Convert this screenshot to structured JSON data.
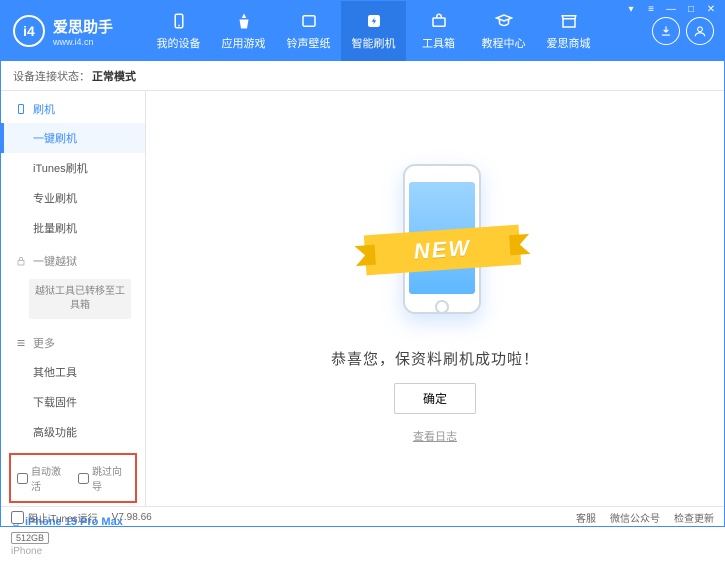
{
  "app": {
    "title": "爱思助手",
    "url": "www.i4.cn"
  },
  "nav": [
    {
      "label": "我的设备"
    },
    {
      "label": "应用游戏"
    },
    {
      "label": "铃声壁纸"
    },
    {
      "label": "智能刷机"
    },
    {
      "label": "工具箱"
    },
    {
      "label": "教程中心"
    },
    {
      "label": "爱思商城"
    }
  ],
  "status": {
    "label": "设备连接状态：",
    "value": "正常模式"
  },
  "sidebar": {
    "flash_group": "刷机",
    "flash_items": [
      "一键刷机",
      "iTunes刷机",
      "专业刷机",
      "批量刷机"
    ],
    "jailbreak_group": "一键越狱",
    "jailbreak_note": "越狱工具已转移至工具箱",
    "more_group": "更多",
    "more_items": [
      "其他工具",
      "下载固件",
      "高级功能"
    ],
    "chk_auto": "自动激活",
    "chk_skip": "跳过向导"
  },
  "device": {
    "name": "iPhone 15 Pro Max",
    "storage": "512GB",
    "type": "iPhone"
  },
  "main": {
    "ribbon": "NEW",
    "message": "恭喜您，保资料刷机成功啦！",
    "ok": "确定",
    "log": "查看日志"
  },
  "footer": {
    "block_itunes": "阻止iTunes运行",
    "version": "V7.98.66",
    "links": [
      "客服",
      "微信公众号",
      "检查更新"
    ]
  }
}
